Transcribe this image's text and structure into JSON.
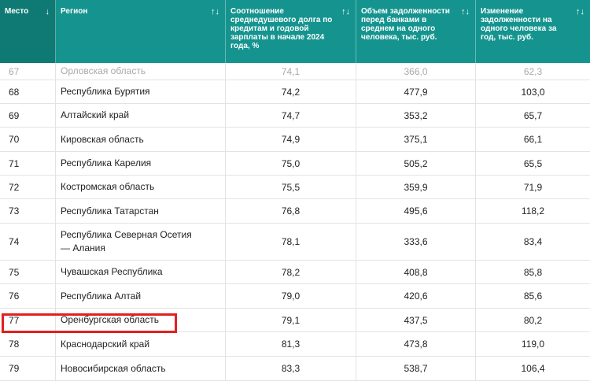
{
  "columns": [
    {
      "label": "Место",
      "sort": "↓"
    },
    {
      "label": "Регион",
      "sort": "↑↓"
    },
    {
      "label": "Соотношение среднедушевого долга по кредитам и годовой зарплаты в начале 2024 года, %",
      "sort": "↑↓"
    },
    {
      "label": "Объем задолженности перед банками в среднем на одного человека, тыс. руб.",
      "sort": "↑↓"
    },
    {
      "label": "Изменение задолженности на одного человека за год, тыс. руб.",
      "sort": "↑↓"
    }
  ],
  "rows": [
    {
      "place": "67",
      "region": "Орловская область",
      "ratio": "74,1",
      "debt": "366,0",
      "change": "62,3"
    },
    {
      "place": "68",
      "region": "Республика Бурятия",
      "ratio": "74,2",
      "debt": "477,9",
      "change": "103,0"
    },
    {
      "place": "69",
      "region": "Алтайский край",
      "ratio": "74,7",
      "debt": "353,2",
      "change": "65,7"
    },
    {
      "place": "70",
      "region": "Кировская область",
      "ratio": "74,9",
      "debt": "375,1",
      "change": "66,1"
    },
    {
      "place": "71",
      "region": "Республика Карелия",
      "ratio": "75,0",
      "debt": "505,2",
      "change": "65,5"
    },
    {
      "place": "72",
      "region": "Костромская область",
      "ratio": "75,5",
      "debt": "359,9",
      "change": "71,9"
    },
    {
      "place": "73",
      "region": "Республика Татарстан",
      "ratio": "76,8",
      "debt": "495,6",
      "change": "118,2"
    },
    {
      "place": "74",
      "region": "Республика Северная Осетия — Алания",
      "ratio": "78,1",
      "debt": "333,6",
      "change": "83,4"
    },
    {
      "place": "75",
      "region": "Чувашская Республика",
      "ratio": "78,2",
      "debt": "408,8",
      "change": "85,8"
    },
    {
      "place": "76",
      "region": "Республика Алтай",
      "ratio": "79,0",
      "debt": "420,6",
      "change": "85,6"
    },
    {
      "place": "77",
      "region": "Оренбургская область",
      "ratio": "79,1",
      "debt": "437,5",
      "change": "80,2"
    },
    {
      "place": "78",
      "region": "Краснодарский край",
      "ratio": "81,3",
      "debt": "473,8",
      "change": "119,0"
    },
    {
      "place": "79",
      "region": "Новосибирская область",
      "ratio": "83,3",
      "debt": "538,7",
      "change": "106,4"
    }
  ],
  "colors": {
    "header": "#15948f",
    "header_first": "#0f7a74",
    "highlight": "#e2201e"
  }
}
